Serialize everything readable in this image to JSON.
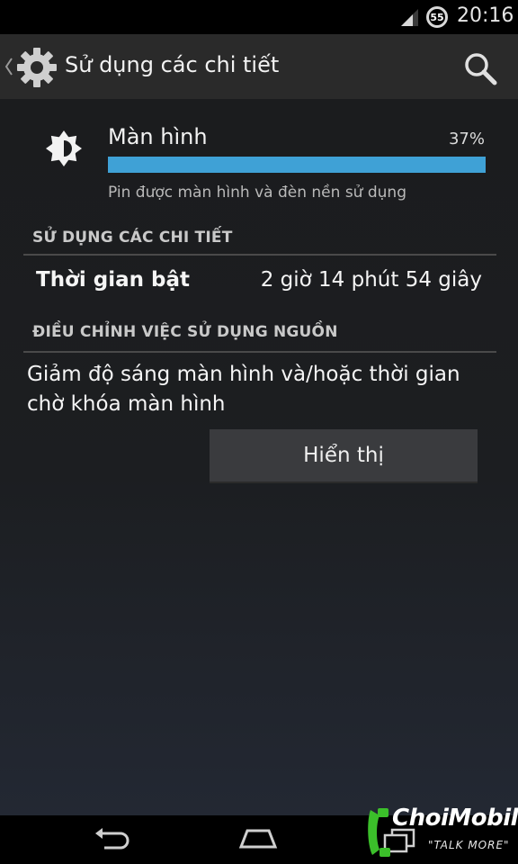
{
  "status_bar": {
    "battery_level": "55",
    "time": "20:16"
  },
  "action_bar": {
    "title": "Sử dụng các chi tiết"
  },
  "app_usage": {
    "name": "Màn hình",
    "percent": "37%",
    "progress_fraction": 1.0,
    "description": "Pin được màn hình và đèn nền sử dụng"
  },
  "details": {
    "header": "SỬ DỤNG CÁC CHI TIẾT",
    "on_time_label": "Thời gian bật",
    "on_time_value": "2 giờ 14 phút 54 giây"
  },
  "adjust": {
    "header": "ĐIỀU CHỈNH VIỆC SỬ DỤNG NGUỒN",
    "advice": "Giảm độ sáng màn hình và/hoặc thời gian chờ khóa màn hình",
    "button_label": "Hiển thị"
  },
  "watermark": {
    "brand": "ChoiMobile",
    "slogan": "\"TALK MORE\""
  },
  "colors": {
    "accent": "#3fa1d6",
    "action_bar": "#2a2a2a",
    "background": "#1b1c1e"
  },
  "icons": {
    "app": "gear-icon",
    "search": "search-icon",
    "usage": "brightness-icon",
    "nav": [
      "back-icon",
      "home-icon",
      "recent-apps-icon"
    ]
  }
}
